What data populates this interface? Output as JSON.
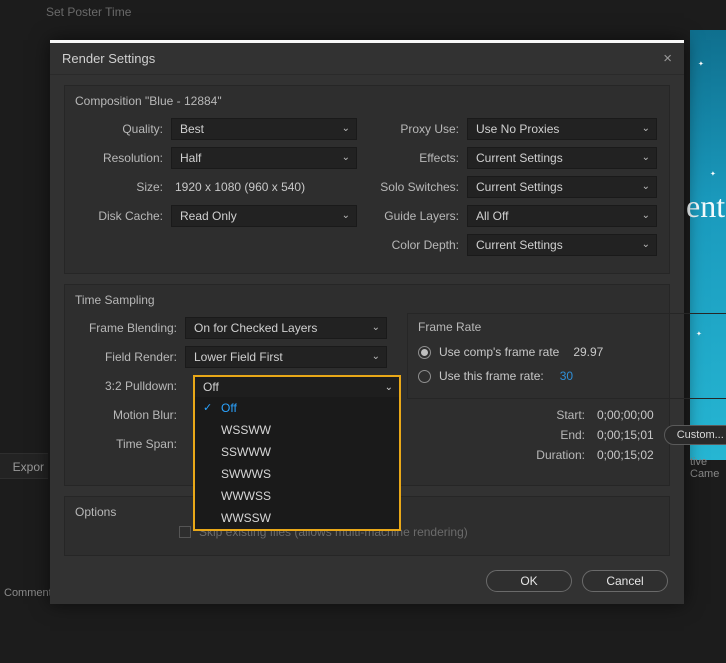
{
  "bg": {
    "poster_btn": "Set Poster Time",
    "right_text": "ent",
    "right_small": "tive Came",
    "export": "Expor",
    "comment": "Comment"
  },
  "dialog": {
    "title": "Render Settings",
    "close_glyph": "×",
    "comp_line": "Composition \"Blue - 12884\"",
    "left": {
      "quality_k": "Quality:",
      "quality_v": "Best",
      "resolution_k": "Resolution:",
      "resolution_v": "Half",
      "size_k": "Size:",
      "size_v": "1920 x 1080 (960 x 540)",
      "disk_k": "Disk Cache:",
      "disk_v": "Read Only"
    },
    "right": {
      "proxy_k": "Proxy Use:",
      "proxy_v": "Use No Proxies",
      "effects_k": "Effects:",
      "effects_v": "Current Settings",
      "solo_k": "Solo Switches:",
      "solo_v": "Current Settings",
      "guide_k": "Guide Layers:",
      "guide_v": "All Off",
      "depth_k": "Color Depth:",
      "depth_v": "Current Settings"
    },
    "ts": {
      "title": "Time Sampling",
      "fb_k": "Frame Blending:",
      "fb_v": "On for Checked Layers",
      "fr_k": "Field Render:",
      "fr_v": "Lower Field First",
      "pd_k": "3:2 Pulldown:",
      "pd_v": "Off",
      "mb_k": "Motion Blur:",
      "span_k": "Time Span:",
      "options": [
        "Off",
        "WSSWW",
        "SSWWW",
        "SWWWS",
        "WWWSS",
        "WWSSW"
      ],
      "fr_box": {
        "title": "Frame Rate",
        "r1_label": "Use comp's frame rate",
        "r1_val": "29.97",
        "r2_label": "Use this frame rate:",
        "r2_val": "30"
      },
      "info": {
        "start_k": "Start:",
        "start_v": "0;00;00;00",
        "end_k": "End:",
        "end_v": "0;00;15;01",
        "dur_k": "Duration:",
        "dur_v": "0;00;15;02",
        "custom": "Custom..."
      }
    },
    "opts": {
      "title": "Options",
      "skip": "Skip existing files (allows multi-machine rendering)"
    },
    "footer": {
      "ok": "OK",
      "cancel": "Cancel"
    }
  }
}
